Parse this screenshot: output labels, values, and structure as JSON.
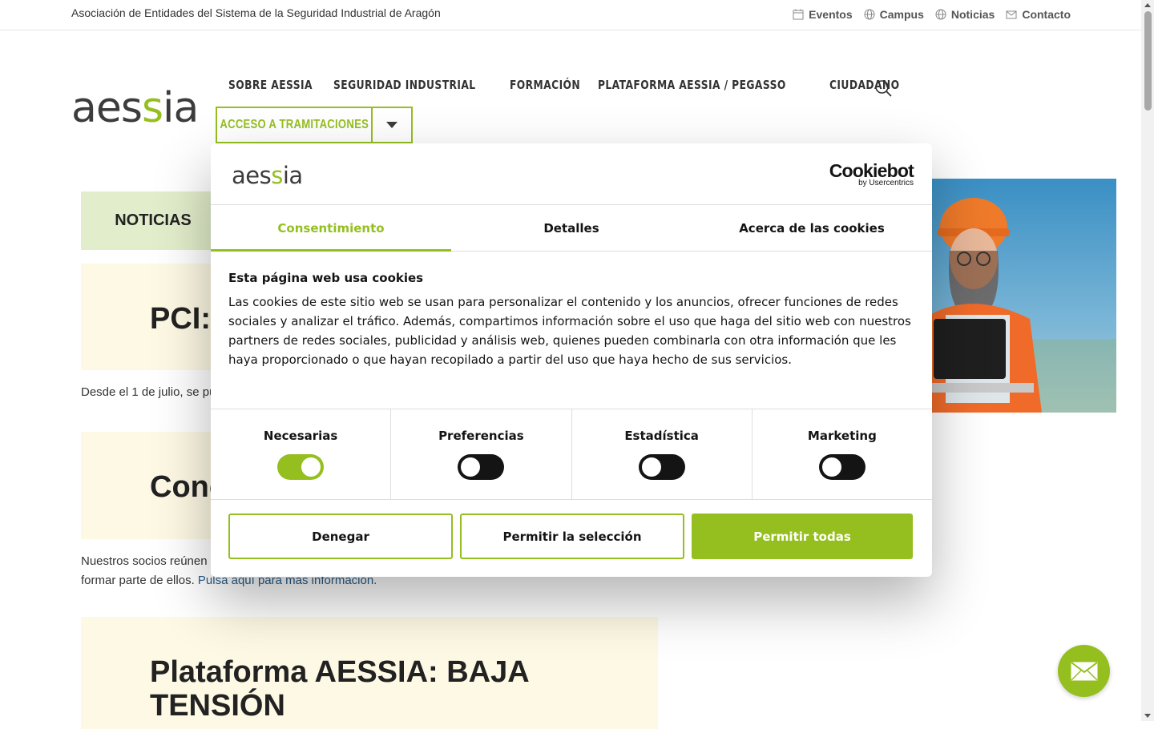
{
  "topbar": {
    "association": "Asociación de Entidades del Sistema de la Seguridad Industrial de Aragón",
    "links": [
      {
        "label": "Eventos",
        "icon": "calendar-icon"
      },
      {
        "label": "Campus",
        "icon": "globe-icon"
      },
      {
        "label": "Noticias",
        "icon": "globe-icon"
      },
      {
        "label": "Contacto",
        "icon": "mail-icon"
      }
    ]
  },
  "brand": {
    "logo_text_dark": "aes",
    "logo_text_green": "s",
    "logo_text_end": "ia",
    "colors": {
      "green": "#95bf1f",
      "dark": "#3c3c3c"
    }
  },
  "nav": {
    "items": [
      "SOBRE AESSIA",
      "SEGURIDAD INDUSTRIAL",
      "FORMACIÓN",
      "PLATAFORMA AESSIA / PEGASSO",
      "CIUDADANO"
    ],
    "tramitaciones": "ACCESO A TRAMITACIONES"
  },
  "content": {
    "tab": "NOTICIAS",
    "card1_title": "PCI: ",
    "card1_text": "Desde el 1 de julio, se pu",
    "card2_title": "Conc",
    "card2_text_line1": "Nuestros socios reúnen",
    "card2_text_line2": "formar parte de ellos. ",
    "card2_link": "Pulsa aquí para más información.",
    "card3_title": "Plataforma AESSIA: BAJA TENSIÓN"
  },
  "cookie": {
    "provider_name": "Cookiebot",
    "provider_sub": "by Usercentrics",
    "tabs": [
      "Consentimiento",
      "Detalles",
      "Acerca de las cookies"
    ],
    "active_tab": 0,
    "title": "Esta página web usa cookies",
    "text": "Las cookies de este sitio web se usan para personalizar el contenido y los anuncios, ofrecer funciones de redes sociales y analizar el tráfico. Además, compartimos información sobre el uso que haga del sitio web con nuestros partners de redes sociales, publicidad y análisis web, quienes pueden combinarla con otra información que les haya proporcionado o que hayan recopilado a partir del uso que haya hecho de sus servicios.",
    "categories": [
      {
        "label": "Necesarias",
        "on": true
      },
      {
        "label": "Preferencias",
        "on": false
      },
      {
        "label": "Estadística",
        "on": false
      },
      {
        "label": "Marketing",
        "on": false
      }
    ],
    "buttons": {
      "deny": "Denegar",
      "allow_selection": "Permitir la selección",
      "allow_all": "Permitir todas"
    }
  }
}
